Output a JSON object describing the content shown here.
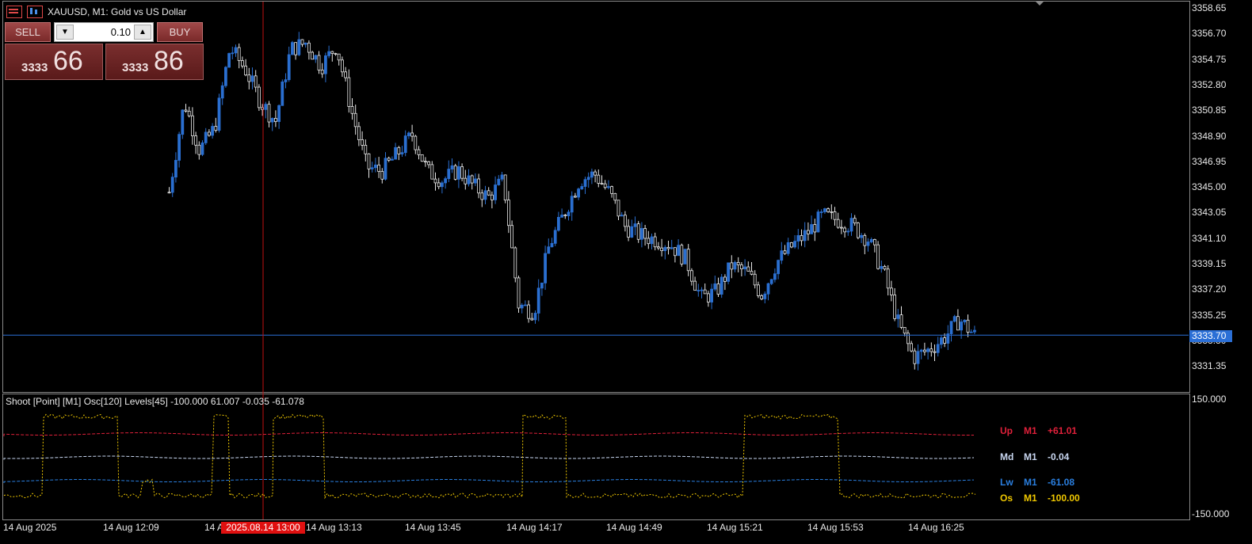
{
  "window": {
    "symbol_title": "XAUUSD, M1:  Gold vs US Dollar"
  },
  "trade_panel": {
    "sell_label": "SELL",
    "buy_label": "BUY",
    "volume_value": "0.10",
    "sell_price_small": "3333",
    "sell_price_big": "66",
    "buy_price_small": "3333",
    "buy_price_big": "86",
    "icons": [
      "chart-list-icon",
      "chart-bars-icon",
      "arrow-down-icon",
      "arrow-up-icon"
    ]
  },
  "price_axis": {
    "labels": [
      "3358.65",
      "3356.70",
      "3354.75",
      "3352.80",
      "3350.85",
      "3348.90",
      "3346.95",
      "3345.00",
      "3343.05",
      "3341.10",
      "3339.15",
      "3337.20",
      "3335.25",
      "3333.30",
      "3331.35"
    ],
    "current_price": "3333.70"
  },
  "indicator": {
    "label": "Shoot [Point] [M1]  Osc[120]  Levels[45] -100.000 61.007 -0.035 -61.078",
    "axis_labels": [
      "150.000",
      "-150.000"
    ],
    "legend": [
      {
        "name": "Up",
        "tf": "M1",
        "value": "+61.01",
        "color": "#e0203a"
      },
      {
        "name": "Md",
        "tf": "M1",
        "value": "-0.04",
        "color": "#c8d6f0"
      },
      {
        "name": "Lw",
        "tf": "M1",
        "value": "-61.08",
        "color": "#2a7fe0"
      },
      {
        "name": "Os",
        "tf": "M1",
        "value": "-100.00",
        "color": "#f0c800"
      }
    ]
  },
  "time_axis": {
    "labels": [
      "14 Aug 2025",
      "14 Aug 12:09",
      "14 A",
      "14 Aug 13:13",
      "14 Aug 13:45",
      "14 Aug 14:17",
      "14 Aug 14:49",
      "14 Aug 15:21",
      "14 Aug 15:53",
      "14 Aug 16:25"
    ],
    "crosshair_time": "2025.08.14 13:00"
  },
  "colors": {
    "bull_candle": "#2a6fd0",
    "bear_candle": "#e8e8e8",
    "crosshair": "#c01010",
    "price_line": "#2b6fd6",
    "osc_line": "#f0c800"
  },
  "chart_data": {
    "type": "candlestick",
    "price_range": [
      3330.5,
      3359.0
    ],
    "current_price": 3333.7,
    "close_path": [
      3344.6,
      3351.5,
      3347.8,
      3349.5,
      3355.6,
      3354.0,
      3351.5,
      3350.0,
      3355.5,
      3356.0,
      3354.2,
      3355.8,
      3350.8,
      3346.5,
      3346.2,
      3347.5,
      3349.0,
      3346.2,
      3345.5,
      3346.3,
      3345.1,
      3344.2,
      3345.5,
      3336.0,
      3335.5,
      3340.5,
      3343.0,
      3345.5,
      3346.0,
      3344.5,
      3342.0,
      3341.3,
      3341.0,
      3340.6,
      3339.5,
      3336.5,
      3337.0,
      3339.0,
      3338.5,
      3336.8,
      3339.3,
      3340.5,
      3341.5,
      3342.8,
      3342.5,
      3342.0,
      3341.0,
      3338.5,
      3334.5,
      3332.0,
      3332.6,
      3333.5,
      3334.9,
      3333.7
    ],
    "osc_levels": {
      "up": 61.01,
      "md": -0.04,
      "lw": -61.08,
      "os": -100.0
    },
    "osc_range": [
      -150,
      150
    ]
  }
}
